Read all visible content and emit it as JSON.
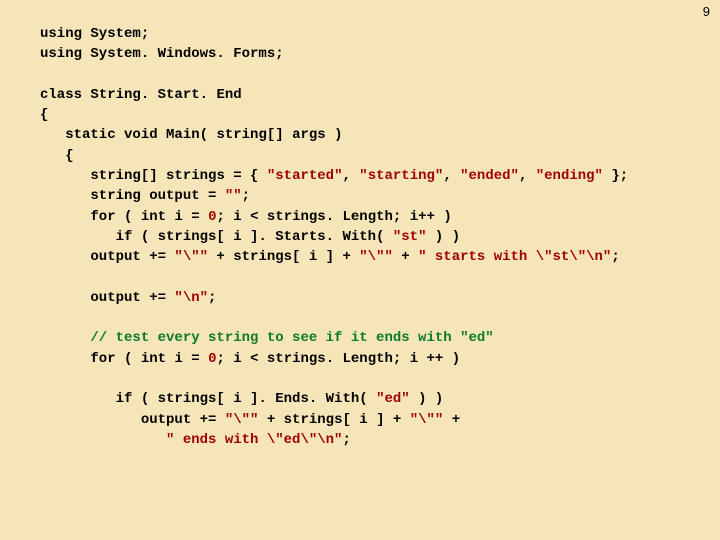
{
  "page_number": "9",
  "code": {
    "l01": "using System;",
    "l02": "using System. Windows. Forms;",
    "l03_a": "class",
    "l03_b": " String. Start. End",
    "l04": "{",
    "l05_a": "   static void",
    "l05_b": " Main( ",
    "l05_c": "string",
    "l05_d": "[] args )",
    "l06": "   {",
    "l07_a": "      string",
    "l07_b": "[] strings = { ",
    "l07_c": "\"started\"",
    "l07_d": ", ",
    "l07_e": "\"starting\"",
    "l07_f": ", ",
    "l07_g": "\"ended\"",
    "l07_h": ", ",
    "l07_i": "\"ending\"",
    "l07_j": " };",
    "l08_a": "      string",
    "l08_b": " output = ",
    "l08_c": "\"\"",
    "l08_d": ";",
    "l09_a": "      for",
    "l09_b": " ( ",
    "l09_c": "int",
    "l09_d": " i = ",
    "l09_e": "0",
    "l09_f": "; i < strings. Length; i++ )",
    "l10_a": "         if",
    "l10_b": " ( strings[ i ]. Starts. With( ",
    "l10_c": "\"st\"",
    "l10_d": " ) )",
    "l11_a": "      output += ",
    "l11_b": "\"\\\"\"",
    "l11_c": " + strings[ i ] + ",
    "l11_d": "\"\\\"\"",
    "l11_e": " + ",
    "l11_f": "\" starts with \\\"st\\\"\\n\"",
    "l11_g": ";",
    "l12_a": "      output += ",
    "l12_b": "\"\\n\"",
    "l12_c": ";",
    "l13": "      // test every string to see if it ends with \"ed\"",
    "l14_a": "      for",
    "l14_b": " ( ",
    "l14_c": "int",
    "l14_d": " i = ",
    "l14_e": "0",
    "l14_f": "; i < strings. Length; i ++ )",
    "l15_a": "         if",
    "l15_b": " ( strings[ i ]. Ends. With( ",
    "l15_c": "\"ed\"",
    "l15_d": " ) )",
    "l16_a": "            output += ",
    "l16_b": "\"\\\"\"",
    "l16_c": " + strings[ i ] + ",
    "l16_d": "\"\\\"\"",
    "l16_e": " +",
    "l17_a": "               ",
    "l17_b": "\" ends with \\\"ed\\\"\\n\"",
    "l17_c": ";"
  }
}
